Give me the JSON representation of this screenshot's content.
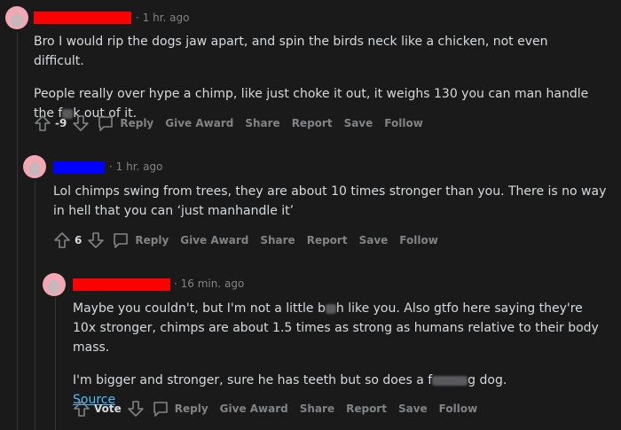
{
  "comments": [
    {
      "username_redaction_color": "#ff0000",
      "time": "1 hr. ago",
      "paragraphs": [
        [
          "Bro I would rip the dogs jaw apart, and spin the birds neck like a chicken, not even difficult."
        ],
        [
          "People really over hype a chimp, like just choke it out, it weighs 130 you can man handle the f",
          "k out of it."
        ]
      ],
      "score": "-9",
      "actions": {
        "reply": "Reply",
        "give_award": "Give Award",
        "share": "Share",
        "report": "Report",
        "save": "Save",
        "follow": "Follow"
      }
    },
    {
      "username_redaction_color": "#0000ff",
      "time": "1 hr. ago",
      "paragraphs": [
        [
          "Lol chimps swing from trees, they are about 10 times stronger than you. There is no way in hell that you can ‘just manhandle it’"
        ]
      ],
      "score": "6",
      "actions": {
        "reply": "Reply",
        "give_award": "Give Award",
        "share": "Share",
        "report": "Report",
        "save": "Save",
        "follow": "Follow"
      }
    },
    {
      "username_redaction_color": "#ff0000",
      "time": "16 min. ago",
      "paragraphs": [
        [
          "Maybe you couldn't, but I'm not a little b",
          "h like you. Also gtfo here saying they're 10x stronger, chimps are about 1.5 times as strong as humans relative to their body mass."
        ],
        [
          "I'm bigger and stronger, sure he has teeth but so does a f",
          "g dog."
        ]
      ],
      "link": "Source",
      "score": "Vote",
      "actions": {
        "reply": "Reply",
        "give_award": "Give Award",
        "share": "Share",
        "report": "Report",
        "save": "Save",
        "follow": "Follow"
      }
    }
  ]
}
